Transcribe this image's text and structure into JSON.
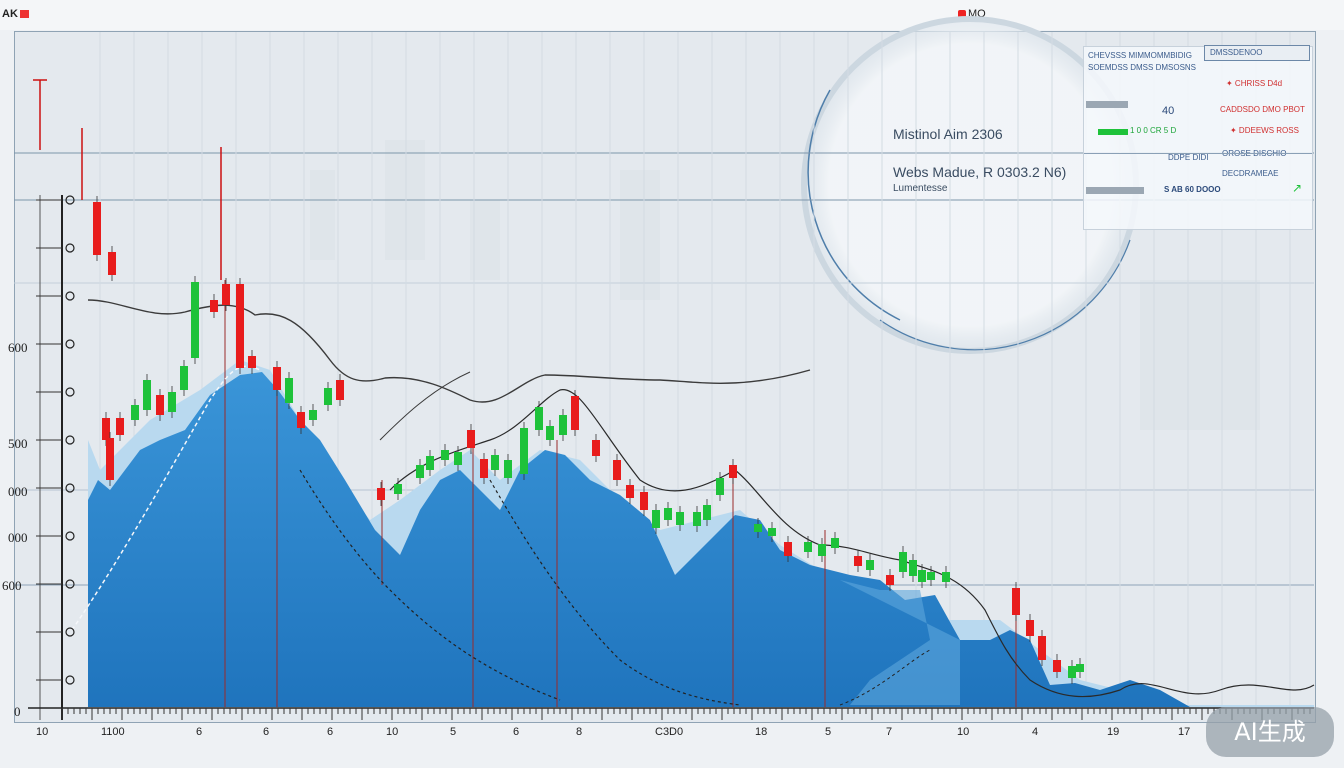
{
  "header": {
    "left_text": "AK",
    "right_text": "MO"
  },
  "info": {
    "line1": "Mistinol  Aim 2306",
    "line2": "Webs Madue,  R  0303.2 N6)",
    "line3": "Lumentesse"
  },
  "panel": {
    "row1_left": "CHEVSSS MIMMOMMBIDIG",
    "row1_right": "DMSSDENOO",
    "row2_left": "SOEMDSS DMSS DMSOSNS",
    "row2_right": "✦ CHRISS D4d",
    "row3_mid": "40",
    "row3_right": "CADDSDO DMO PBOT",
    "row4_left": "1 0 0  CR 5 D",
    "row4_right": "✦ DDEEWS  ROSS",
    "row5_left": "DDPE  DIDI",
    "row5_right": "OROSE DISCHIO",
    "row6_right": "DECDRAMEAE",
    "row7": "S AB 60 DOOO"
  },
  "chart_data": {
    "type": "area",
    "title": "",
    "xlabel": "",
    "ylabel": "",
    "y_tick_labels": [
      "600",
      "500",
      "000",
      "000",
      "600",
      "0"
    ],
    "x_tick_labels": [
      "10",
      "1100",
      "6",
      "6",
      "6",
      "10",
      "5",
      "6",
      "8",
      "C3D0",
      "18",
      "5",
      "7",
      "10",
      "4",
      "19",
      "17"
    ],
    "badge": "AI生成",
    "colors": {
      "area": "#2a86cf",
      "area_light": "#9fcbea",
      "candle_up": "#1ec23a",
      "candle_down": "#e81c1c",
      "trend_line": "#333333",
      "dashed_line": "#222222",
      "wick_red": "#cc1111"
    }
  }
}
